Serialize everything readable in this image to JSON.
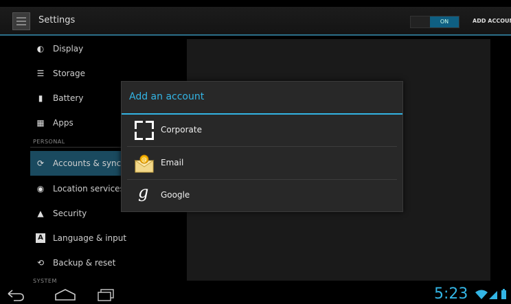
{
  "actionbar": {
    "title": "Settings",
    "toggle_label": "ON",
    "add_account_label": "ADD ACCOUNT"
  },
  "sidebar": {
    "items": [
      {
        "label": "Display",
        "icon": "display-icon"
      },
      {
        "label": "Storage",
        "icon": "storage-icon"
      },
      {
        "label": "Battery",
        "icon": "battery-icon"
      },
      {
        "label": "Apps",
        "icon": "apps-icon"
      },
      {
        "label": "Accounts & sync",
        "icon": "sync-icon",
        "active": true
      },
      {
        "label": "Location services",
        "icon": "location-icon"
      },
      {
        "label": "Security",
        "icon": "lock-icon"
      },
      {
        "label": "Language & input",
        "icon": "language-icon"
      },
      {
        "label": "Backup & reset",
        "icon": "backup-icon"
      }
    ],
    "section_personal": "PERSONAL",
    "section_system": "SYSTEM"
  },
  "dialog": {
    "title": "Add an account",
    "items": [
      {
        "label": "Corporate",
        "icon": "corporate-icon"
      },
      {
        "label": "Email",
        "icon": "email-icon"
      },
      {
        "label": "Google",
        "icon": "google-icon"
      }
    ]
  },
  "statusbar": {
    "time": "5:23"
  },
  "colors": {
    "accent": "#33b5e5",
    "active_item_bg": "#1a4a5f",
    "background": "#000000"
  }
}
